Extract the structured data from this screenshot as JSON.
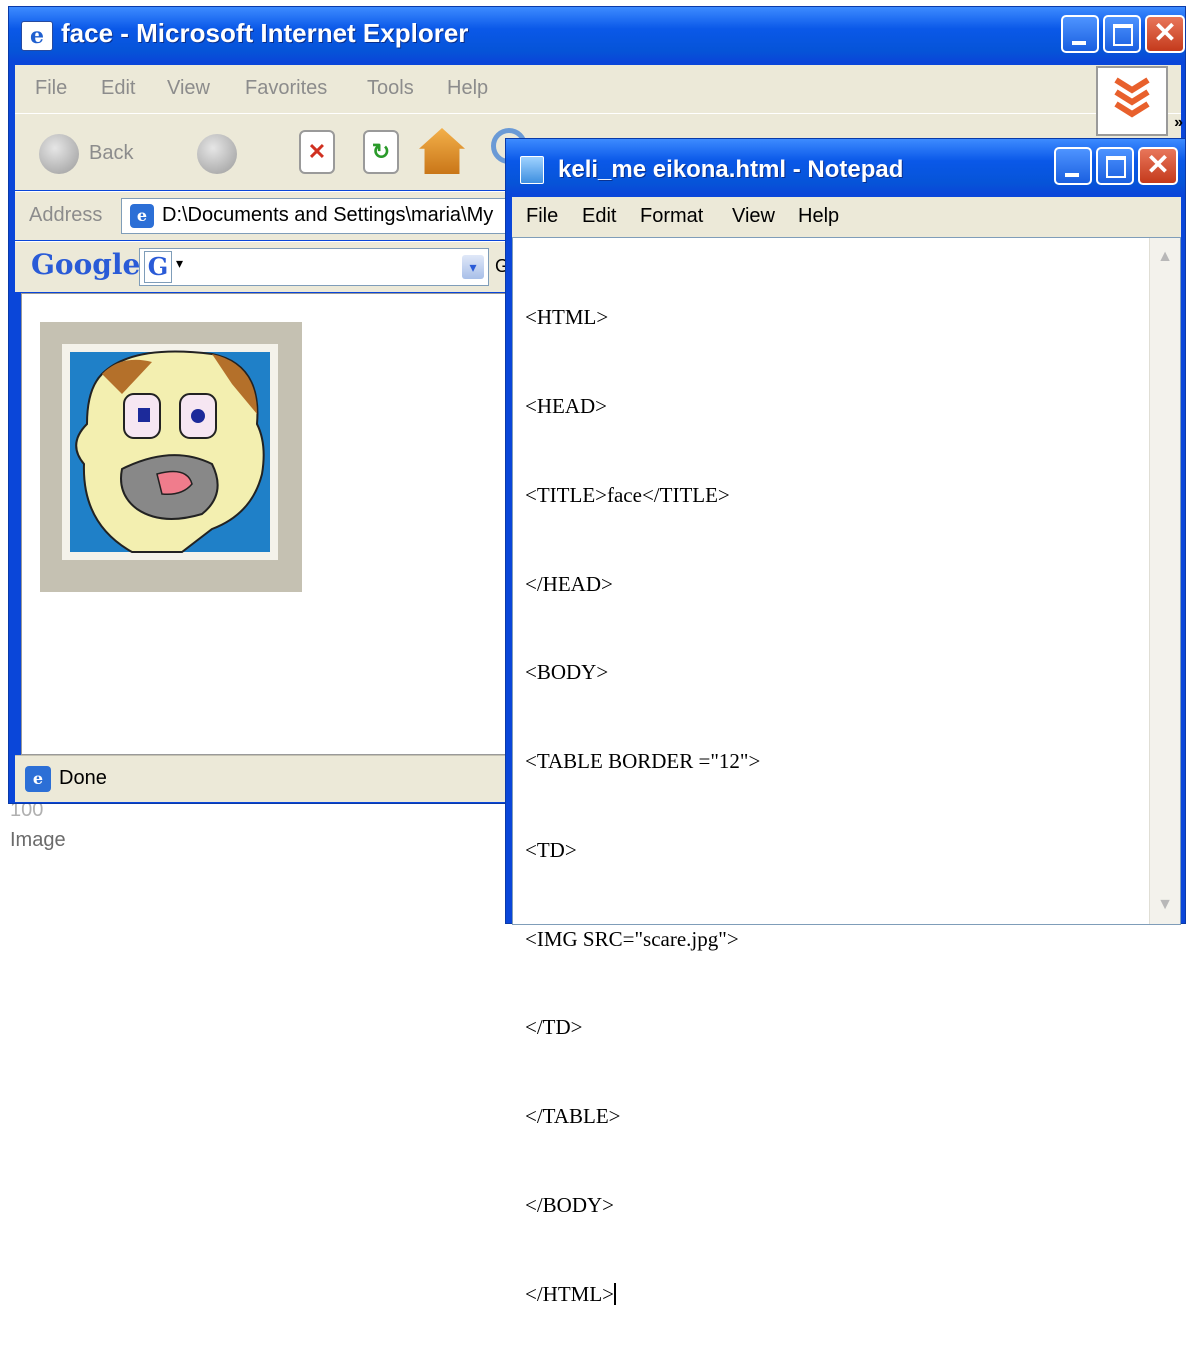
{
  "desktop": {
    "line1": "100",
    "line2": "Image"
  },
  "ie": {
    "title": "face - Microsoft Internet Explorer",
    "menu": [
      "File",
      "Edit",
      "View",
      "Favorites",
      "Tools",
      "Help"
    ],
    "toolbar": {
      "back": "Back",
      "overflow": "»"
    },
    "address": {
      "label": "Address",
      "value": "D:\\Documents and Settings\\maria\\My"
    },
    "google": {
      "brand": "Google",
      "go": "Go"
    },
    "status": "Done"
  },
  "notepad": {
    "title": "keli_me eikona.html - Notepad",
    "menu": [
      "File",
      "Edit",
      "Format",
      "View",
      "Help"
    ],
    "lines": [
      "<HTML>",
      "<HEAD>",
      "<TITLE>face</TITLE>",
      "</HEAD>",
      "<BODY>",
      "<TABLE BORDER =\"12\">",
      "<TD>",
      "<IMG SRC=\"scare.jpg\">",
      "</TD>",
      "</TABLE>",
      "</BODY>",
      "</HTML>"
    ]
  },
  "icons": {
    "ie_window": "ie-page-icon",
    "notepad_window": "notepad-icon",
    "download": "triple-chevron-down-icon"
  },
  "colors": {
    "titlebar": "#0a58e8",
    "chrome": "#ece9d8",
    "close": "#c43a1c"
  }
}
